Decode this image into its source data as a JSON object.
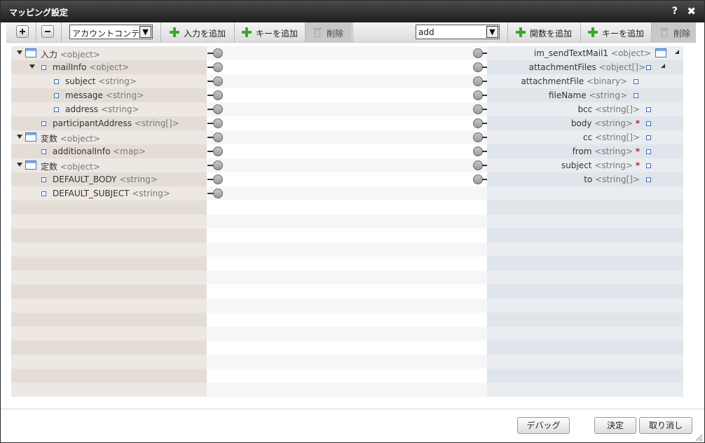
{
  "window": {
    "title": "マッピング設定",
    "help_label": "?",
    "close_label": "✖"
  },
  "toolbar": {
    "source_select_value": "アカウントコンテ",
    "add_input_label": "入力を追加",
    "add_key_left_label": "キーを追加",
    "delete_left_label": "削除",
    "function_select_value": "add",
    "add_function_label": "関数を追加",
    "add_key_right_label": "キーを追加",
    "delete_right_label": "削除"
  },
  "colors": {
    "left_stripe_a": "#ede8e3",
    "left_stripe_b": "#e4ddd6",
    "mid_stripe_a": "#f6f6f6",
    "mid_stripe_b": "#ffffff",
    "right_stripe_a": "#e9edf0",
    "right_stripe_b": "#dfe5ea",
    "required_mark": "#d21a1a",
    "add_icon": "#39a828"
  },
  "left_tree": [
    {
      "name": "入力",
      "type": "<object>",
      "icon": "object-icon",
      "expanded": true
    },
    {
      "name": "mailInfo",
      "type": "<object>",
      "icon": "square-icon",
      "expanded": true
    },
    {
      "name": "subject",
      "type": "<string>",
      "icon": "square-icon"
    },
    {
      "name": "message",
      "type": "<string>",
      "icon": "square-icon"
    },
    {
      "name": "address",
      "type": "<string>",
      "icon": "square-icon"
    },
    {
      "name": "participantAddress",
      "type": "<string[]>",
      "icon": "square-icon"
    },
    {
      "name": "変数",
      "type": "<object>",
      "icon": "object-icon",
      "expanded": true
    },
    {
      "name": "additionalInfo",
      "type": "<map>",
      "icon": "square-icon"
    },
    {
      "name": "定数",
      "type": "<object>",
      "icon": "object-icon",
      "expanded": true
    },
    {
      "name": "DEFAULT_BODY",
      "type": "<string>",
      "icon": "square-icon"
    },
    {
      "name": "DEFAULT_SUBJECT",
      "type": "<string>",
      "icon": "square-icon"
    }
  ],
  "right_tree": [
    {
      "name": "im_sendTextMail1",
      "type": "<object>",
      "icon": "object-icon",
      "expanded": true
    },
    {
      "name": "attachmentFiles",
      "type": "<object[]>",
      "icon": "square-icon",
      "expanded": true
    },
    {
      "name": "attachmentFile",
      "type": "<binary>",
      "icon": "square-icon"
    },
    {
      "name": "fileName",
      "type": "<string>",
      "icon": "square-icon"
    },
    {
      "name": "bcc",
      "type": "<string[]>",
      "icon": "square-icon"
    },
    {
      "name": "body",
      "type": "<string>",
      "icon": "square-icon",
      "required": "*"
    },
    {
      "name": "cc",
      "type": "<string[]>",
      "icon": "square-icon"
    },
    {
      "name": "from",
      "type": "<string>",
      "icon": "square-icon",
      "required": "*"
    },
    {
      "name": "subject",
      "type": "<string>",
      "icon": "square-icon",
      "required": "*"
    },
    {
      "name": "to",
      "type": "<string[]>",
      "icon": "square-icon"
    }
  ],
  "footer": {
    "debug_label": "デバッグ",
    "ok_label": "決定",
    "cancel_label": "取り消し"
  }
}
